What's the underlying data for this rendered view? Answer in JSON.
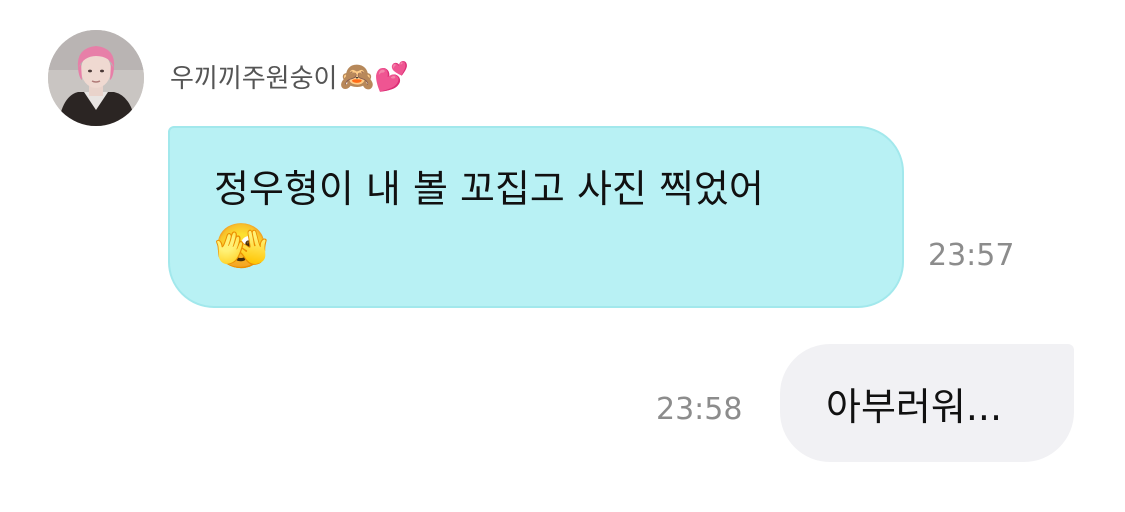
{
  "sender": {
    "name": "우끼끼주원숭이",
    "emojis": "🙈💕",
    "avatar_icon": "profile-photo-pink-hair"
  },
  "messages": [
    {
      "direction": "incoming",
      "text": "정우형이 내 볼 꼬집고 사진 찍었어",
      "emoji": "🫣",
      "time": "23:57"
    },
    {
      "direction": "outgoing",
      "text": "아부러워...",
      "time": "23:58"
    }
  ],
  "colors": {
    "incoming_bubble": "#b8f1f4",
    "outgoing_bubble": "#f1f1f4",
    "timestamp": "#8c8c8c"
  }
}
